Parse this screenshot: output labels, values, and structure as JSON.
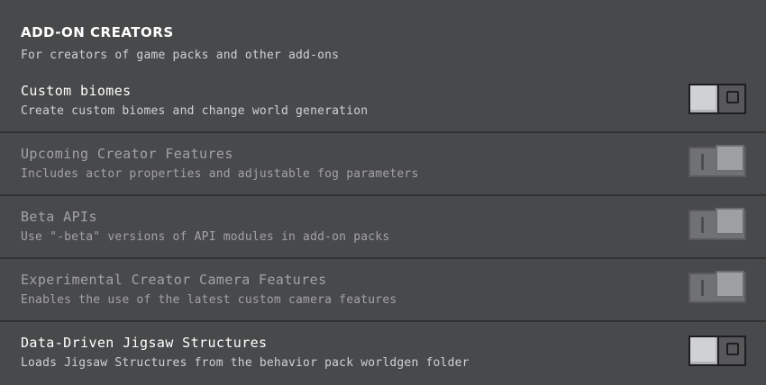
{
  "section": {
    "title": "ADD-ON CREATORS",
    "description": "For creators of game packs and other add-ons"
  },
  "toggles": [
    {
      "title": "Custom biomes",
      "description": "Create custom biomes and change world generation",
      "state": "off",
      "enabled": true,
      "glyph": "O"
    },
    {
      "title": "Upcoming Creator Features",
      "description": "Includes actor properties and adjustable fog parameters",
      "state": "on",
      "enabled": false,
      "glyph": "I"
    },
    {
      "title": "Beta APIs",
      "description": "Use \"-beta\" versions of API modules in add-on packs",
      "state": "on",
      "enabled": false,
      "glyph": "I"
    },
    {
      "title": "Experimental Creator Camera Features",
      "description": "Enables the use of the latest custom camera features",
      "state": "on",
      "enabled": false,
      "glyph": "I"
    },
    {
      "title": "Data-Driven Jigsaw Structures",
      "description": "Loads Jigsaw Structures from the behavior pack worldgen folder",
      "state": "off",
      "enabled": true,
      "glyph": "O"
    }
  ],
  "colors": {
    "background": "#48494a",
    "separator": "#333334",
    "text": "#ffffff",
    "subtext": "#d0d1d4",
    "disabled_text": "#a3a3a5"
  }
}
